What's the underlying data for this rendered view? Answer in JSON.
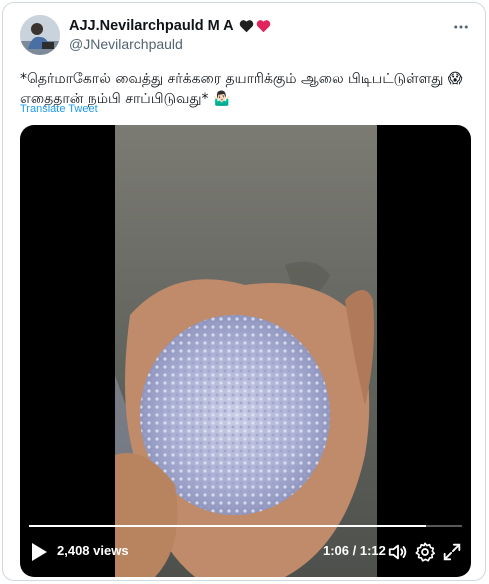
{
  "author": {
    "display_name": "AJJ.Nevilarchpauld M A",
    "name_emojis": [
      "black-heart",
      "red-heart"
    ],
    "handle": "@JNevilarchpauld"
  },
  "tweet": {
    "text": "*தெர்மாகோல் வைத்து சர்க்கரை தயாரிக்கும் ஆலை பிடிபட்டுள்ளது 😱 எதைதான் நம்பி சாப்பிடுவது* 🤷🏻‍♂️",
    "translate_label": "Translate Tweet"
  },
  "video": {
    "views": "2,408 views",
    "time": "1:06 / 1:12",
    "progress": 0.917
  },
  "icons": [
    "more-icon",
    "play-icon",
    "volume-icon",
    "settings-icon",
    "fullscreen-icon"
  ],
  "colors": {
    "link": "#1d9bf0",
    "heart_black": "#1f1f1f",
    "heart_red": "#e0245e"
  }
}
